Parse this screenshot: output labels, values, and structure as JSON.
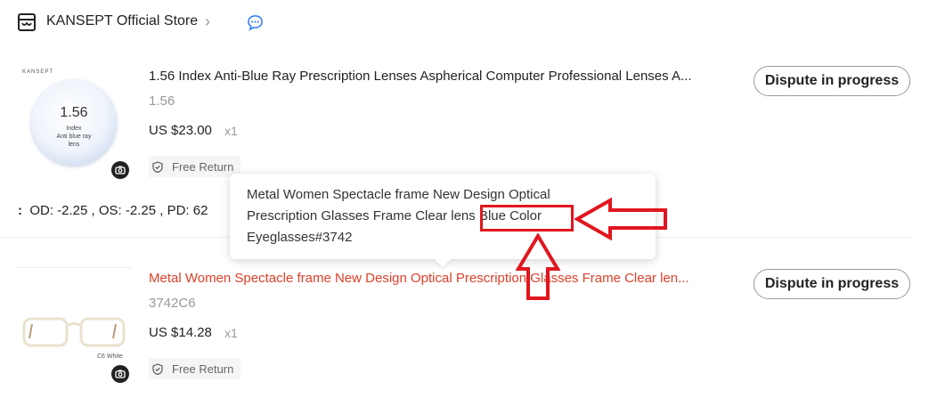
{
  "store": {
    "name": "KANSEPT Official Store"
  },
  "orders": [
    {
      "title": "1.56 Index Anti-Blue Ray Prescription Lenses Aspherical Computer Professional Lenses A...",
      "sku": "1.56",
      "price": "US $23.00",
      "qty": "x1",
      "badge": "Free Return",
      "button": "Dispute in progress",
      "image_text": {
        "brand": "KANSEPT",
        "big": "1.56",
        "l1": "Index",
        "l2": "Anti blue ray",
        "l3": "lens"
      }
    },
    {
      "title": "Metal Women Spectacle frame New Design Optical Prescription Glasses Frame Clear len...",
      "sku": "3742C6",
      "price": "US $14.28",
      "qty": "x1",
      "badge": "Free Return",
      "button": "Dispute in progress",
      "image_text": {
        "label": "C6 White"
      }
    }
  ],
  "prescription": "OD: -2.25 , OS: -2.25 , PD: 62",
  "tooltip": {
    "line1": "Metal Women Spectacle frame New Design Optical",
    "line2_start": "Prescription Glasses Frame Clear lens",
    "line2_highlight": "Blue Color",
    "line3": "Eyeglasses#3742"
  },
  "colors": {
    "title_link": "#e0402a",
    "annotation": "#e1161e",
    "chat": "#2f7bf5"
  },
  "icons": [
    "store-icon",
    "chevron-right-icon",
    "chat-icon",
    "camera-icon",
    "shield-check-icon",
    "red-arrow-left",
    "red-arrow-up"
  ]
}
